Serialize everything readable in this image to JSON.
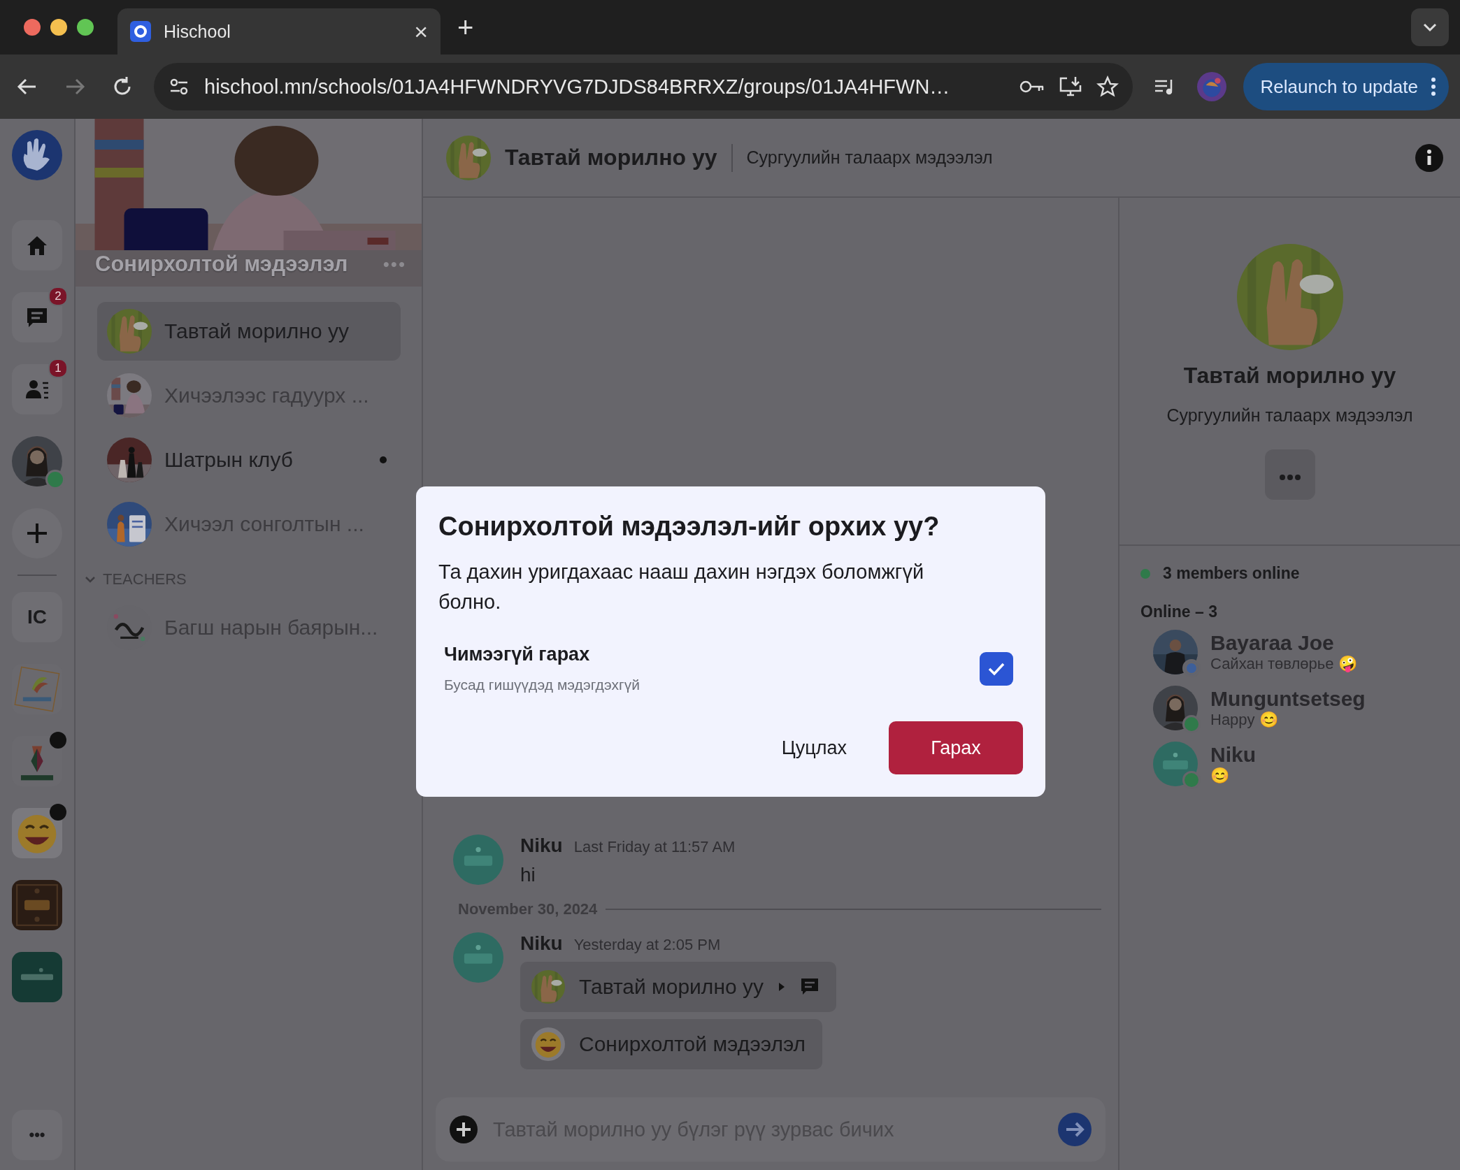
{
  "browser": {
    "tab_title": "Hischool",
    "tab_close": "×",
    "new_tab": "+",
    "url": "hischool.mn/schools/01JA4HFWNDRYVG7DJDS84BRRXZ/groups/01JA4HFWN…",
    "relaunch": "Relaunch to update"
  },
  "rail": {
    "items": [
      {
        "kind": "home"
      },
      {
        "kind": "chat",
        "badge": "2"
      },
      {
        "kind": "people",
        "badge": "1"
      },
      {
        "kind": "avatar",
        "online": true
      },
      {
        "kind": "add"
      },
      {
        "kind": "divider"
      },
      {
        "kind": "initials",
        "label": "IC",
        "unread": false
      },
      {
        "kind": "server",
        "unread": false
      },
      {
        "kind": "server",
        "unread": true
      },
      {
        "kind": "server",
        "unread": true
      },
      {
        "kind": "server",
        "unread": false
      },
      {
        "kind": "server",
        "unread": false
      }
    ],
    "more": "•••"
  },
  "group": {
    "title": "Сонирхолтой мэдээлэл",
    "menu": "•••"
  },
  "channels": [
    {
      "name": "Тавтай морилно уу",
      "selected": true,
      "unread": false
    },
    {
      "name": "Хичээлээс гадуурх ...",
      "selected": false,
      "unread": false
    },
    {
      "name": "Шатрын клуб",
      "selected": false,
      "unread": true
    },
    {
      "name": "Хичээл сонголтын ...",
      "selected": false,
      "unread": false
    }
  ],
  "categories": [
    {
      "name": "TEACHERS",
      "expanded": true,
      "channels": [
        {
          "name": "Багш нарын баярын...",
          "selected": false,
          "unread": false
        }
      ]
    }
  ],
  "header": {
    "title": "Тавтай морилно уу",
    "topic": "Сургуулийн талаарх мэдээлэл"
  },
  "messages": [
    {
      "kind": "message",
      "author": "Niku",
      "time": "Last Friday at 11:57 AM",
      "text": "hi"
    },
    {
      "kind": "divider",
      "date": "November 30, 2024"
    },
    {
      "kind": "message",
      "author": "Niku",
      "time": "Yesterday at 2:05 PM",
      "links": [
        {
          "kind": "channel",
          "label": "Тавтай морилно уу"
        },
        {
          "kind": "group",
          "label": "Сонирхолтой мэдээлэл"
        }
      ]
    }
  ],
  "composer": {
    "placeholder": "Тавтай морилно уу бүлэг рүү зурвас бичих"
  },
  "panel": {
    "title": "Тавтай морилно уу",
    "topic": "Сургуулийн талаарх мэдээлэл",
    "online_summary": "3 members online",
    "section": "Online – 3",
    "members": [
      {
        "name": "Bayaraa Joe",
        "status": "Сайхан төвлөрье 🤪",
        "focus": true
      },
      {
        "name": "Munguntsetseg",
        "status": "Happy 😊",
        "focus": false
      },
      {
        "name": "Niku",
        "status": "😊",
        "focus": false
      }
    ]
  },
  "dialog": {
    "title": "Сонирхолтой мэдээлэл-ийг орхих уу?",
    "text": "Та дахин уригдахаас нааш дахин нэгдэх боломжгүй болно.",
    "option": {
      "label": "Чимээгүй гарах",
      "hint": "Бусад гишүүдэд мэдэгдэхгүй",
      "checked": true
    },
    "cancel": "Цуцлах",
    "confirm": "Гарах"
  }
}
